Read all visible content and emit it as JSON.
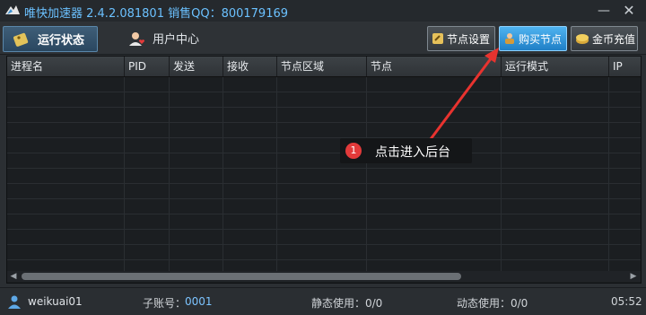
{
  "titlebar": {
    "title": "唯快加速器 2.4.2.081801 销售QQ：800179169",
    "minimize": "—",
    "close": "✕"
  },
  "toolbar": {
    "tab_status": "运行状态",
    "tab_user": "用户中心",
    "btn_node_settings": "节点设置",
    "btn_buy_node": "购买节点",
    "btn_coin_recharge": "金币充值"
  },
  "grid": {
    "columns": [
      "进程名",
      "PID",
      "发送",
      "接收",
      "节点区域",
      "节点",
      "运行模式",
      "IP"
    ],
    "scroll_left": "◀",
    "scroll_right": "▶"
  },
  "callout": {
    "number": "1",
    "text": "点击进入后台"
  },
  "statusbar": {
    "username": "weikuai01",
    "sub_account_label": "子账号：",
    "sub_account_value": "0001",
    "static_use": "静态使用：0/0",
    "dynamic_use": "动态使用：0/0",
    "time": "05:52"
  },
  "colors": {
    "accent": "#4fb3f0",
    "title_text": "#6bc1ff",
    "callout_badge": "#e23a3a",
    "arrow": "#e8332f"
  }
}
